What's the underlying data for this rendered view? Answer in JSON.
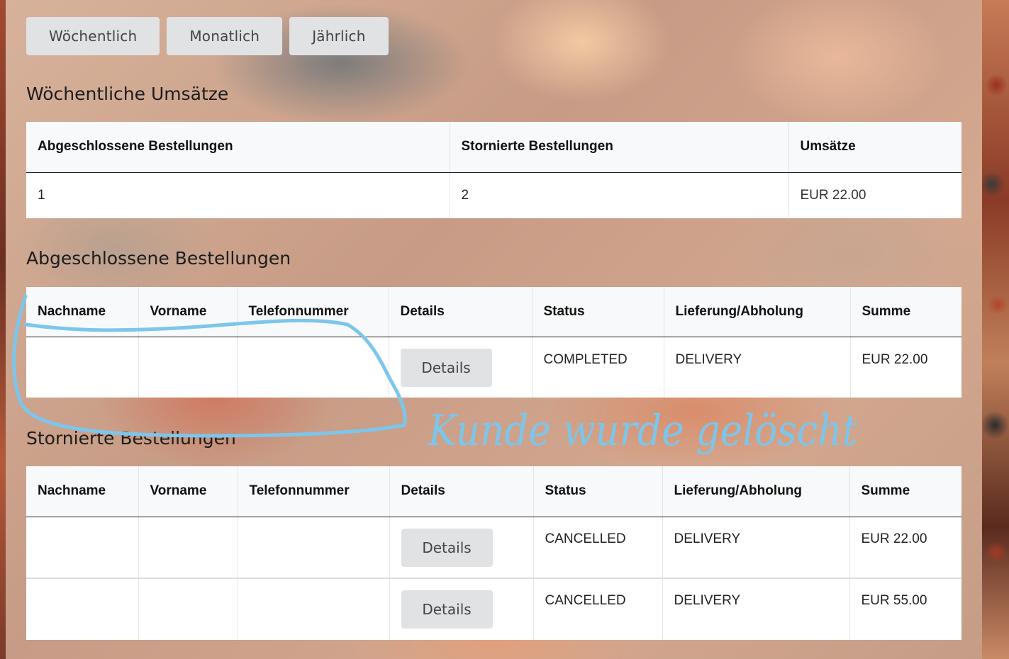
{
  "period_buttons": {
    "weekly": "Wöchentlich",
    "monthly": "Monatlich",
    "yearly": "Jährlich"
  },
  "summary": {
    "title": "Wöchentliche Umsätze",
    "headers": [
      "Abgeschlossene Bestellungen",
      "Stornierte Bestellungen",
      "Umsätze"
    ],
    "values": [
      "1",
      "2",
      "EUR 22.00"
    ]
  },
  "completed": {
    "title": "Abgeschlossene Bestellungen",
    "headers": [
      "Nachname",
      "Vorname",
      "Telefonnummer",
      "Details",
      "Status",
      "Lieferung/Abholung",
      "Summe"
    ],
    "rows": [
      {
        "lastname": "",
        "firstname": "",
        "phone": "",
        "details_label": "Details",
        "status": "COMPLETED",
        "delivery": "DELIVERY",
        "total": "EUR 22.00"
      }
    ]
  },
  "cancelled": {
    "title": "Stornierte Bestellungen",
    "headers": [
      "Nachname",
      "Vorname",
      "Telefonnummer",
      "Details",
      "Status",
      "Lieferung/Abholung",
      "Summe"
    ],
    "rows": [
      {
        "lastname": "",
        "firstname": "",
        "phone": "",
        "details_label": "Details",
        "status": "CANCELLED",
        "delivery": "DELIVERY",
        "total": "EUR 22.00"
      },
      {
        "lastname": "",
        "firstname": "",
        "phone": "",
        "details_label": "Details",
        "status": "CANCELLED",
        "delivery": "DELIVERY",
        "total": "EUR 55.00"
      }
    ]
  },
  "annotation": {
    "handwritten_note": "Kunde wurde gelöscht",
    "color": "#7cc6ec"
  }
}
